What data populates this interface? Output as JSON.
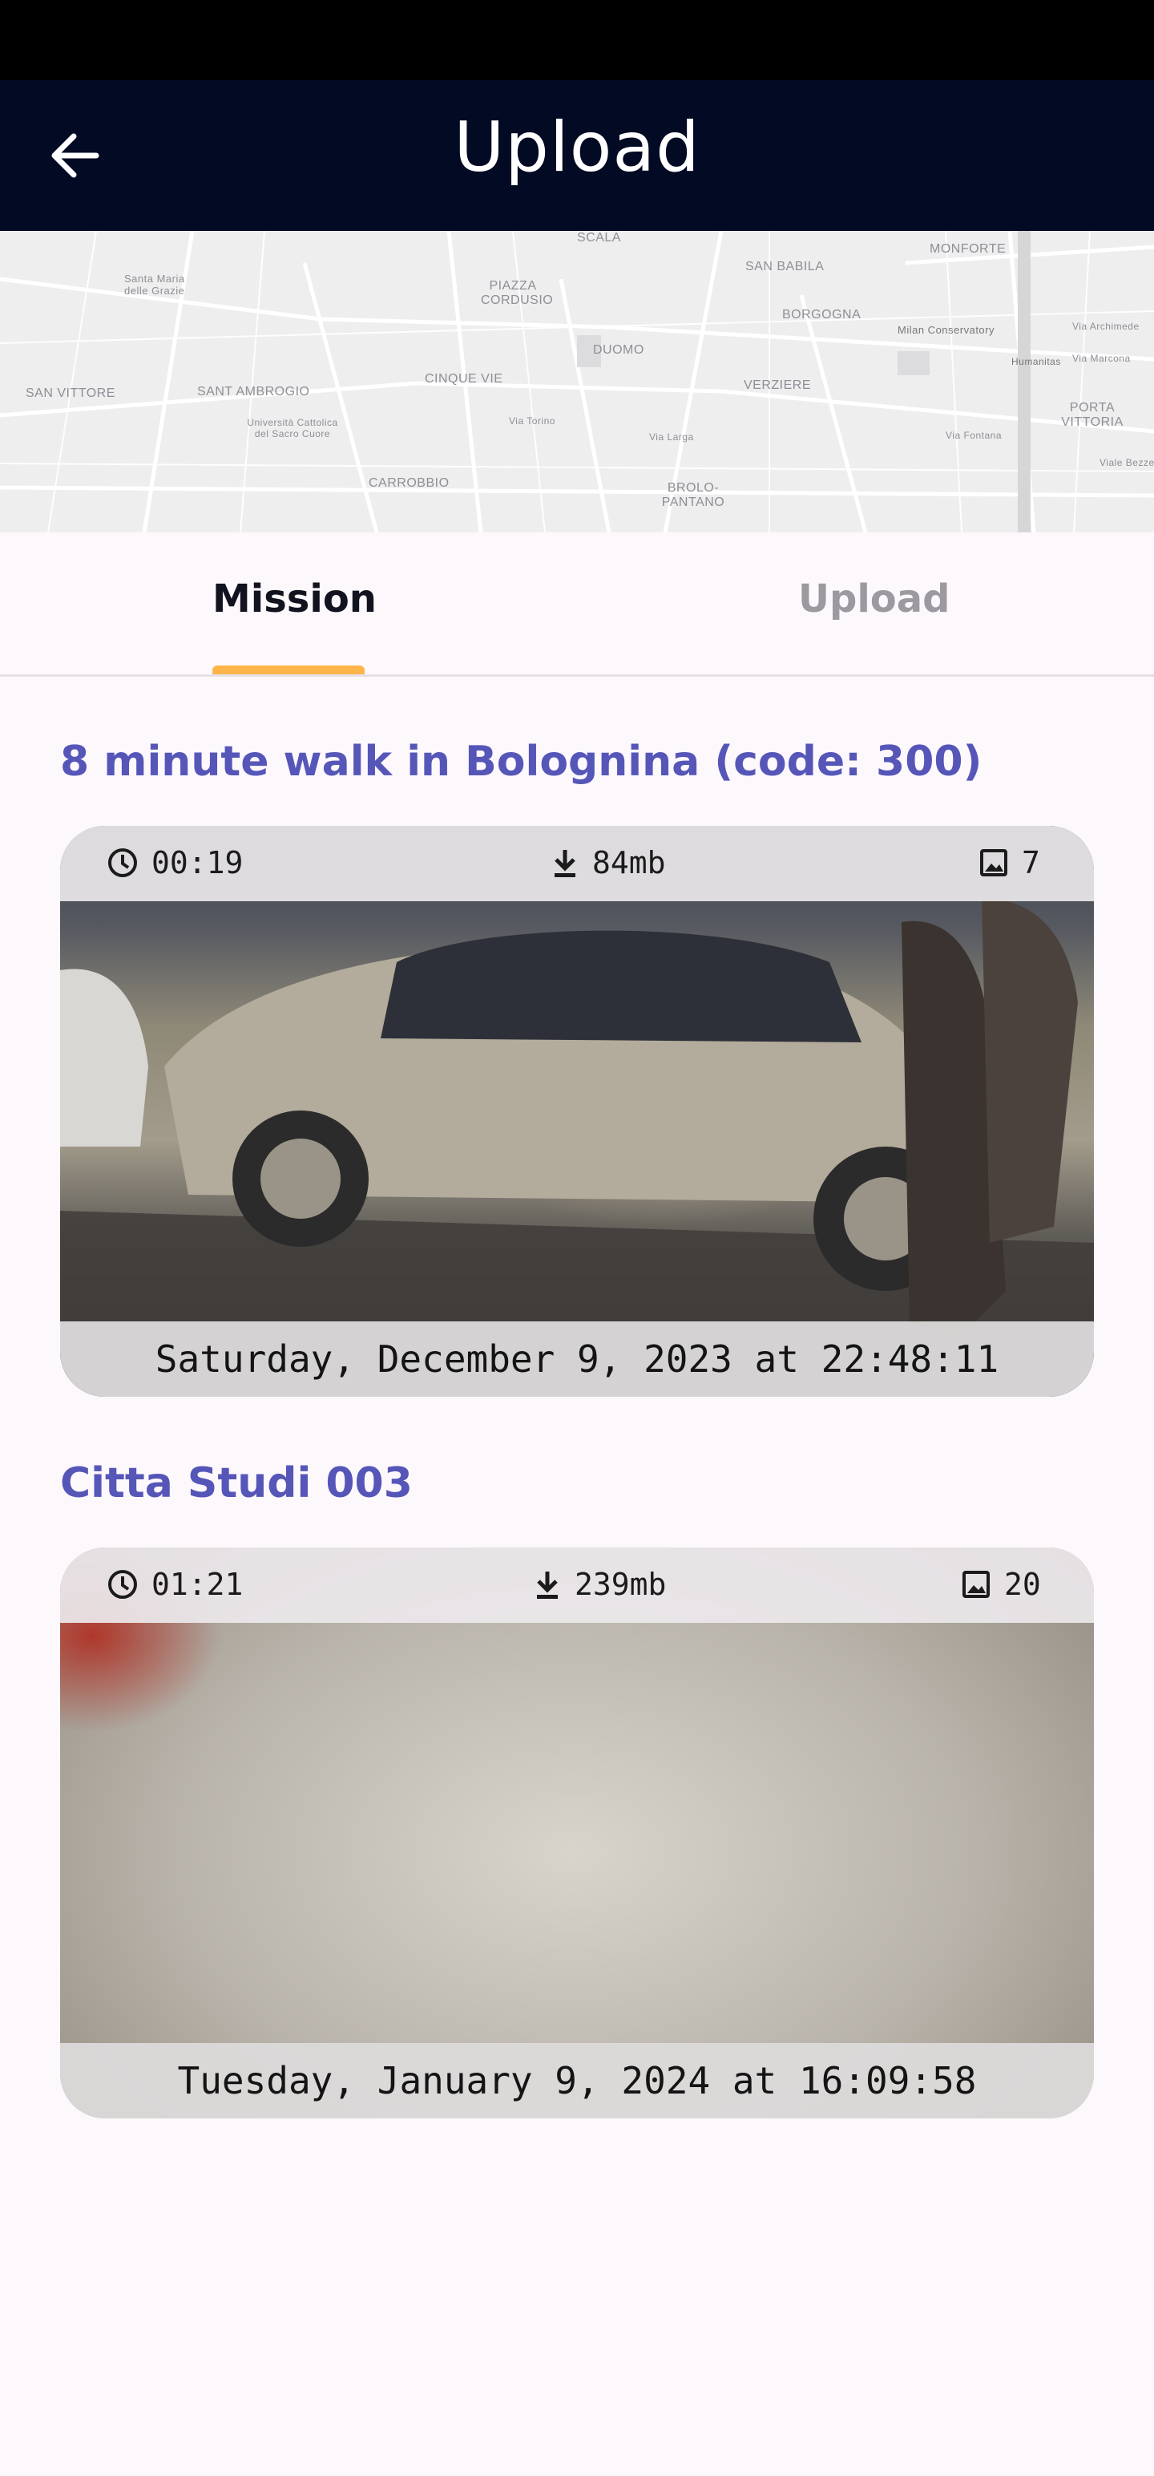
{
  "header": {
    "title": "Upload",
    "back_icon": "arrow-left-icon"
  },
  "map": {
    "labels": [
      "SCALA",
      "MONFORTE",
      "Santa Maria delle Grazie",
      "PIAZZA CORDUSIO",
      "SAN BABILA",
      "BORGOGNA",
      "Milan Conservatory",
      "Via Archimede",
      "SAN VITTORE",
      "SANT AMBROGIO",
      "CINQUE VIE",
      "DUOMO",
      "VERZIERE",
      "Humanitas",
      "Via Marcona",
      "Università Cattolica del Sacro Cuore",
      "Via Torino",
      "Via Larga",
      "Via Fontana",
      "PORTA VITTORIA",
      "CARROBBIO",
      "BROLO-PANTANO",
      "Viale Bezzeca"
    ]
  },
  "tabs": [
    {
      "label": "Mission",
      "active": true
    },
    {
      "label": "Upload",
      "active": false
    }
  ],
  "colors": {
    "accent": "#ffb44a",
    "title": "#5656b8",
    "header_bg": "#020a24"
  },
  "missions": [
    {
      "title": "8 minute walk in Bolognina (code: 300)",
      "duration": "00:19",
      "size": "84mb",
      "images": "7",
      "date": "Saturday, December 9, 2023 at 22:48:11"
    },
    {
      "title": "Citta Studi 003",
      "duration": "01:21",
      "size": "239mb",
      "images": "20",
      "date": "Tuesday, January 9, 2024 at 16:09:58"
    }
  ]
}
